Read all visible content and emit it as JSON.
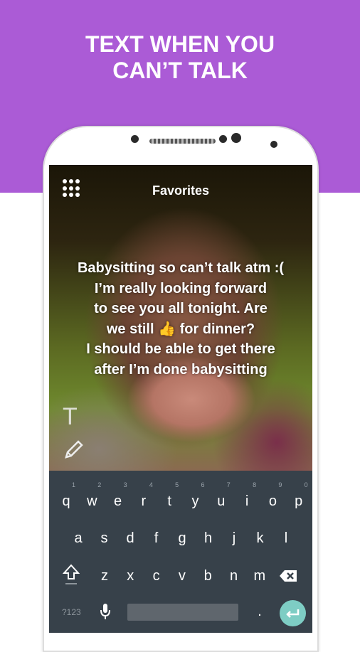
{
  "banner": {
    "line1": "TEXT WHEN YOU",
    "line2": "CAN’T TALK",
    "color": "#ab5bd6"
  },
  "app": {
    "title": "Favorites",
    "menu_icon": "grid-dots-icon",
    "message": [
      "Babysitting so can’t talk atm :(",
      "I’m really looking forward",
      "to see you all tonight. Are",
      "we still 👍 for dinner?",
      "I should be able to get there",
      "after I’m done babysitting"
    ],
    "text_tool": "T",
    "edit_icon": "pencil-icon"
  },
  "keyboard": {
    "row1": [
      [
        "q",
        "1"
      ],
      [
        "w",
        "2"
      ],
      [
        "e",
        "3"
      ],
      [
        "r",
        "4"
      ],
      [
        "t",
        "5"
      ],
      [
        "y",
        "6"
      ],
      [
        "u",
        "7"
      ],
      [
        "i",
        "8"
      ],
      [
        "o",
        "9"
      ],
      [
        "p",
        "0"
      ]
    ],
    "row2": [
      "a",
      "s",
      "d",
      "f",
      "g",
      "h",
      "j",
      "k",
      "l"
    ],
    "row3": [
      "z",
      "x",
      "c",
      "v",
      "b",
      "n",
      "m"
    ],
    "symbols": "?123",
    "period": ".",
    "enter_color": "#7ecdc4"
  }
}
